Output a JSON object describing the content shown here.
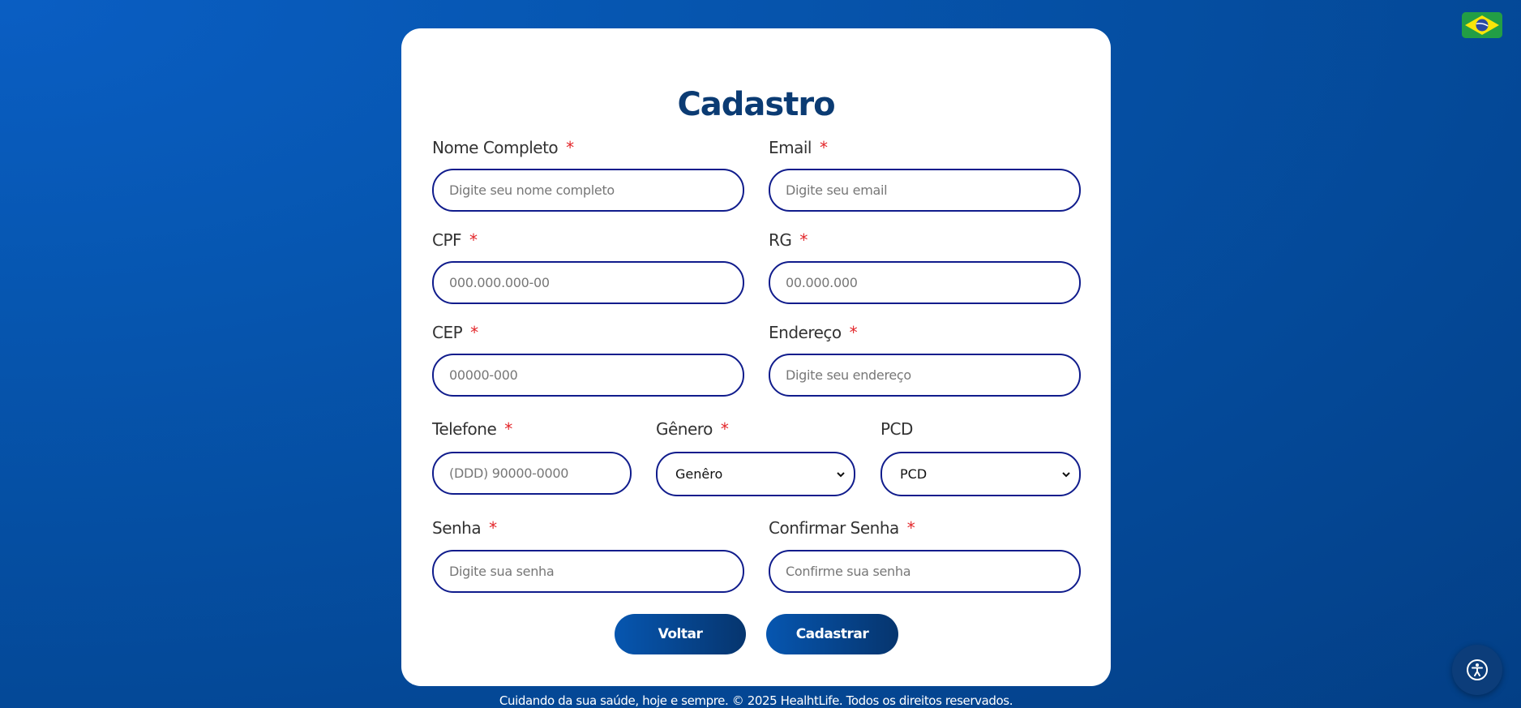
{
  "title": "Cadastro",
  "required_mark": "*",
  "fields": {
    "nome": {
      "label": "Nome Completo",
      "placeholder": "Digite seu nome completo"
    },
    "email": {
      "label": "Email",
      "placeholder": "Digite seu email"
    },
    "cpf": {
      "label": "CPF",
      "placeholder": "000.000.000-00"
    },
    "rg": {
      "label": "RG",
      "placeholder": "00.000.000"
    },
    "cep": {
      "label": "CEP",
      "placeholder": "00000-000"
    },
    "endereco": {
      "label": "Endereço",
      "placeholder": "Digite seu endereço"
    },
    "telefone": {
      "label": "Telefone",
      "placeholder": "(DDD) 90000-0000"
    },
    "genero": {
      "label": "Gênero",
      "selected": "Genêro"
    },
    "pcd": {
      "label": "PCD",
      "selected": "PCD"
    },
    "senha": {
      "label": "Senha",
      "placeholder": "Digite sua senha"
    },
    "confirmar_senha": {
      "label": "Confirmar Senha",
      "placeholder": "Confirme sua senha"
    }
  },
  "buttons": {
    "back": "Voltar",
    "submit": "Cadastrar"
  },
  "footer": "Cuidando da sua saúde, hoje e sempre. © 2025 HealhtLife. Todos os direitos reservados.",
  "icons": {
    "flag": "brazil-flag-icon",
    "accessibility": "accessibility-icon",
    "dropdown": "chevron-down-icon"
  },
  "colors": {
    "brand": "#0b3b73",
    "input_border": "#101c8c",
    "required": "#e3262a",
    "button": "#0656b0"
  }
}
